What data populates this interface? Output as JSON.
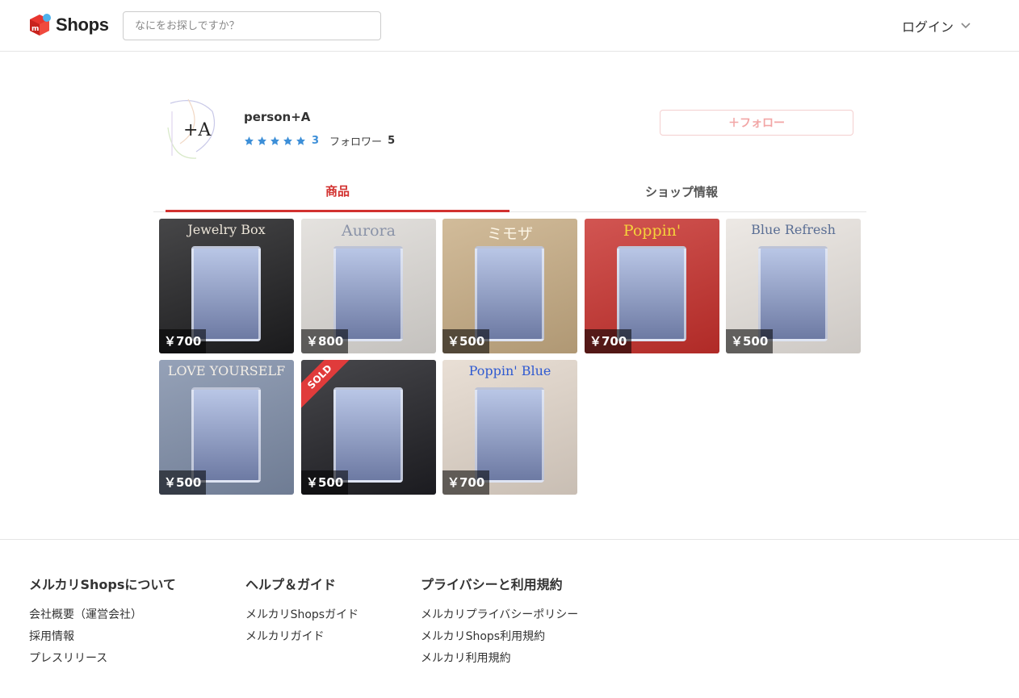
{
  "header": {
    "logo_text": "Shops",
    "search_placeholder": "なにをお探しですか？",
    "login_label": "ログイン"
  },
  "shop": {
    "avatar_text": "+A",
    "name": "person+A",
    "rating_count": "3",
    "follower_label": "フォロワー",
    "follower_count": "5",
    "follow_label": "＋フォロー"
  },
  "tabs": [
    {
      "label": "商品",
      "active": true
    },
    {
      "label": "ショップ情報",
      "active": false
    }
  ],
  "items": [
    {
      "title": "Jewelry Box",
      "price": "￥700",
      "sold": false,
      "bg": "#1e1e20",
      "fg": "#ece5d8"
    },
    {
      "title": "Aurora",
      "price": "￥800",
      "sold": false,
      "bg": "#dfdcd8",
      "fg": "#8a93a8"
    },
    {
      "title": "ミモザ",
      "price": "￥500",
      "sold": false,
      "bg": "#c8ad84",
      "fg": "#fdf6e6"
    },
    {
      "title": "Poppin'",
      "price": "￥700",
      "sold": false,
      "bg": "#c8302c",
      "fg": "#f6d23b"
    },
    {
      "title": "Blue Refresh",
      "price": "￥500",
      "sold": false,
      "bg": "#e9e4df",
      "fg": "#5a6e94"
    },
    {
      "title": "LOVE YOURSELF",
      "price": "￥500",
      "sold": false,
      "bg": "#7e8da8",
      "fg": "#f3eee6"
    },
    {
      "title": "SOLD",
      "price": "￥500",
      "sold": true,
      "bg": "#1f1f24",
      "fg": "#f0d3e6"
    },
    {
      "title": "Poppin' Blue",
      "price": "￥700",
      "sold": false,
      "bg": "#e4d8cc",
      "fg": "#2f5ad1"
    }
  ],
  "footer": {
    "columns": [
      {
        "heading": "メルカリShopsについて",
        "links": [
          "会社概要（運営会社）",
          "採用情報",
          "プレスリリース"
        ]
      },
      {
        "heading": "ヘルプ＆ガイド",
        "links": [
          "メルカリShopsガイド",
          "メルカリガイド"
        ]
      },
      {
        "heading": "プライバシーと利用規約",
        "links": [
          "メルカリプライバシーポリシー",
          "メルカリShops利用規約",
          "メルカリ利用規約"
        ]
      }
    ]
  },
  "colors": {
    "brand_red": "#d2312f",
    "star_blue": "#3d8fd8"
  }
}
